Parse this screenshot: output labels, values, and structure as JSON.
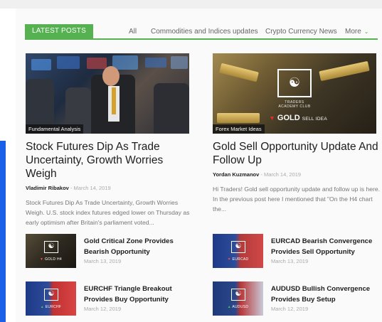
{
  "header": {
    "latest_label": "LATEST POSTS",
    "tabs": [
      {
        "label": "All"
      },
      {
        "label": "Commodities and Indices updates"
      },
      {
        "label": "Crypto Currency News"
      },
      {
        "label": "More"
      }
    ]
  },
  "featured": [
    {
      "category": "Fundamental Analysis",
      "title": "Stock Futures Dip As Trade Uncertainty, Growth Worries Weigh",
      "author": "Vladimir Ribakov",
      "date": "March 14, 2019",
      "excerpt": "Stock Futures Dip As Trade Uncertainty, Growth Worries Weigh. U.S. stock index futures edged lower on Thursday as early optimism after Britain's parliament voted..."
    },
    {
      "category": "Forex Market Ideas",
      "title": "Gold Sell Opportunity Update And Follow Up",
      "author": "Yordan Kuzmanov",
      "date": "March 14, 2019",
      "excerpt": "Hi Traders! Gold sell opportunity update and follow up is here. In the previous post here I mentioned that \"On the H4 chart the...",
      "image_badge": "GOLD",
      "image_badge_sub": "SELL IDEA",
      "image_logo_text": "TRADERS ACADEMY CLUB"
    }
  ],
  "list_posts": [
    {
      "title": "Gold Critical Zone Provides Bearish Opportunity",
      "date": "March 13, 2019",
      "thumb_label": "GOLD H4"
    },
    {
      "title": "EURCAD Bearish Convergence Provides Sell Opportunity",
      "date": "March 13, 2019",
      "thumb_label": "EURCAD"
    },
    {
      "title": "EURCHF Triangle Breakout Provides Buy Opportunity",
      "date": "March 12, 2019",
      "thumb_label": "EURCHF"
    },
    {
      "title": "AUDUSD Bullish Convergence Provides Buy Setup",
      "date": "March 12, 2019",
      "thumb_label": "AUDUSD"
    }
  ],
  "colors": {
    "accent_green": "#56b150",
    "left_accent_blue": "#1a5fe8"
  },
  "icons": {
    "more_tab": "chevron-down-icon",
    "sell_indicator": "triangle-down-icon",
    "buy_indicator": "triangle-up-icon"
  }
}
